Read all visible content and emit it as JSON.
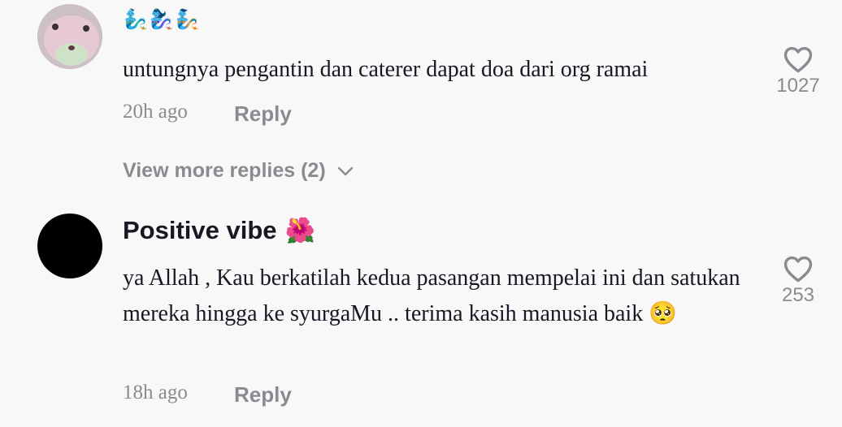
{
  "comment1": {
    "emoji_line": "🧞‍♂️🧞‍♀️🧞",
    "text": "untungnya pengantin dan caterer dapat doa dari org ramai",
    "time": "20h ago",
    "reply_label": "Reply",
    "likes": "1027",
    "view_more_label": "View more replies (2)"
  },
  "comment2": {
    "username": "Positive vibe",
    "username_emoji": "🌺",
    "text": "ya Allah , Kau berkatilah kedua pasangan mempelai ini dan satukan mereka hingga ke syurgaMu .. terima kasih manusia baik 🥺",
    "time": "18h ago",
    "reply_label": "Reply",
    "likes": "253"
  },
  "icons": {
    "like": "heart-outline-icon",
    "expand": "chevron-down-icon"
  },
  "colors": {
    "text": "#161823",
    "muted": "#8a8b91",
    "background": "#f8f8f8"
  }
}
